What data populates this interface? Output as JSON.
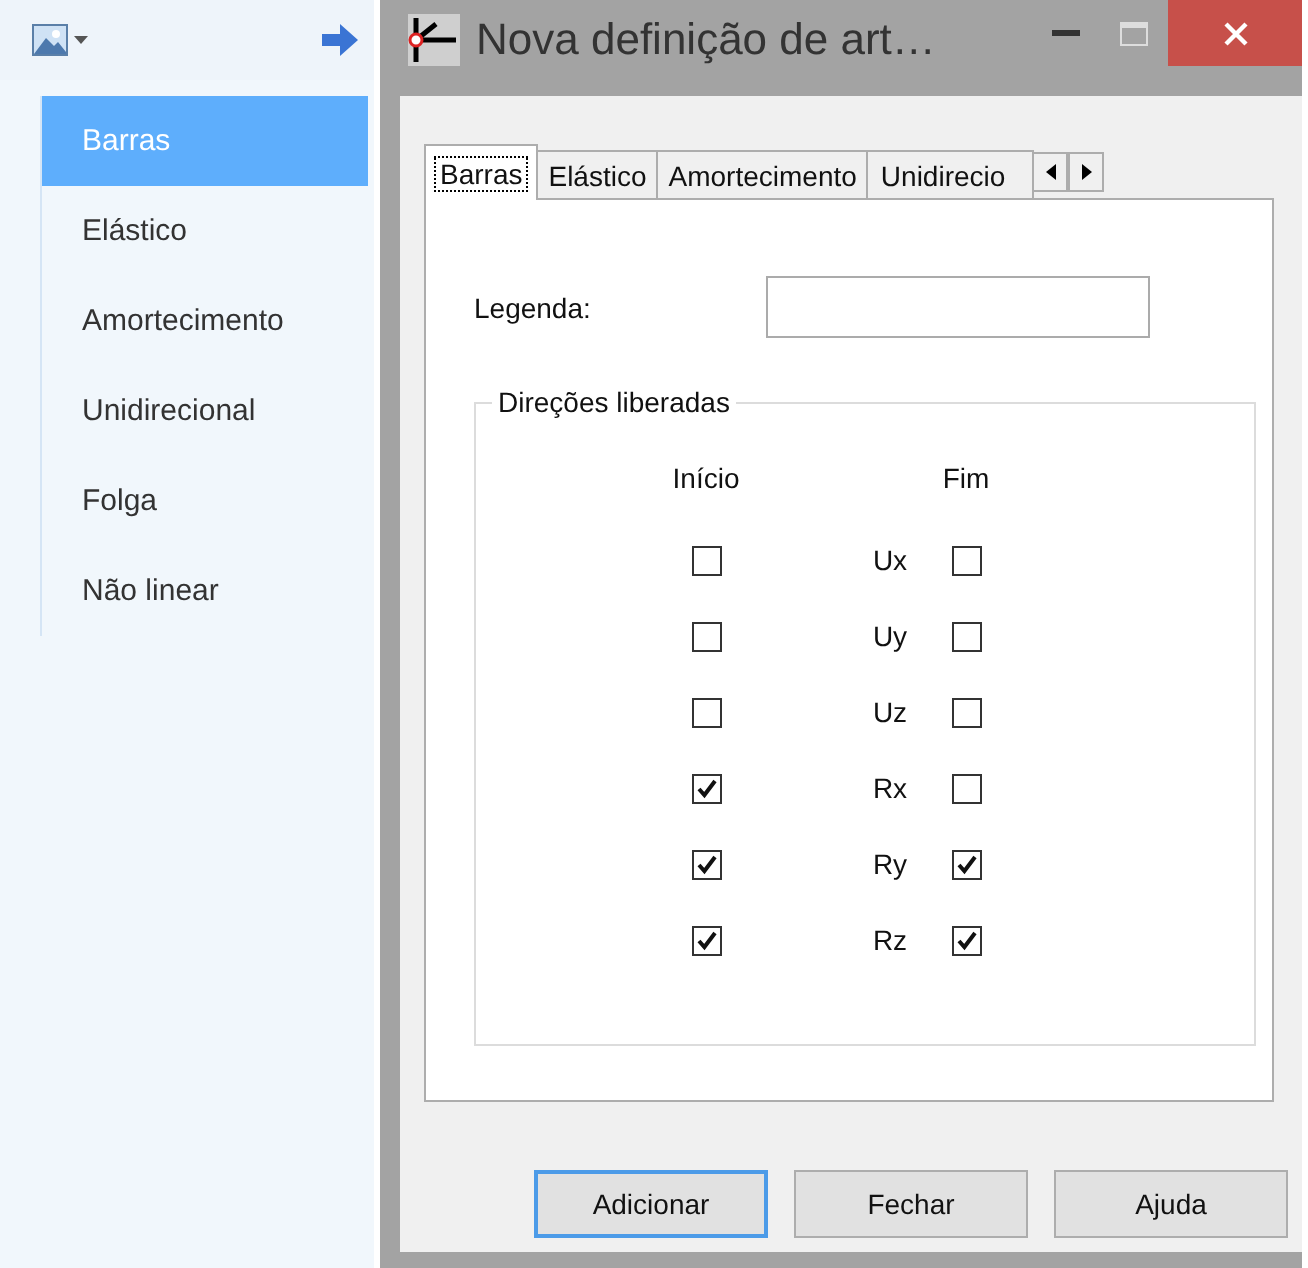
{
  "sidebar": {
    "items": [
      {
        "label": "Barras",
        "selected": true
      },
      {
        "label": "Elástico",
        "selected": false
      },
      {
        "label": "Amortecimento",
        "selected": false
      },
      {
        "label": "Unidirecional",
        "selected": false
      },
      {
        "label": "Folga",
        "selected": false
      },
      {
        "label": "Não linear",
        "selected": false
      }
    ]
  },
  "window": {
    "title": "Nova definição de art…"
  },
  "tabs": [
    {
      "label": "Barras",
      "selected": true
    },
    {
      "label": "Elástico",
      "selected": false
    },
    {
      "label": "Amortecimento",
      "selected": false
    },
    {
      "label": "Unidirecio",
      "selected": false
    }
  ],
  "legend_field": {
    "label": "Legenda:"
  },
  "group": {
    "title": "Direções liberadas",
    "start_header": "Início",
    "end_header": "Fim",
    "rows": [
      {
        "name": "Ux",
        "start": false,
        "end": false
      },
      {
        "name": "Uy",
        "start": false,
        "end": false
      },
      {
        "name": "Uz",
        "start": false,
        "end": false
      },
      {
        "name": "Rx",
        "start": true,
        "end": false
      },
      {
        "name": "Ry",
        "start": true,
        "end": true
      },
      {
        "name": "Rz",
        "start": true,
        "end": true
      }
    ]
  },
  "buttons": [
    {
      "label": "Adicionar",
      "default": true
    },
    {
      "label": "Fechar",
      "default": false
    },
    {
      "label": "Ajuda",
      "default": false
    }
  ]
}
